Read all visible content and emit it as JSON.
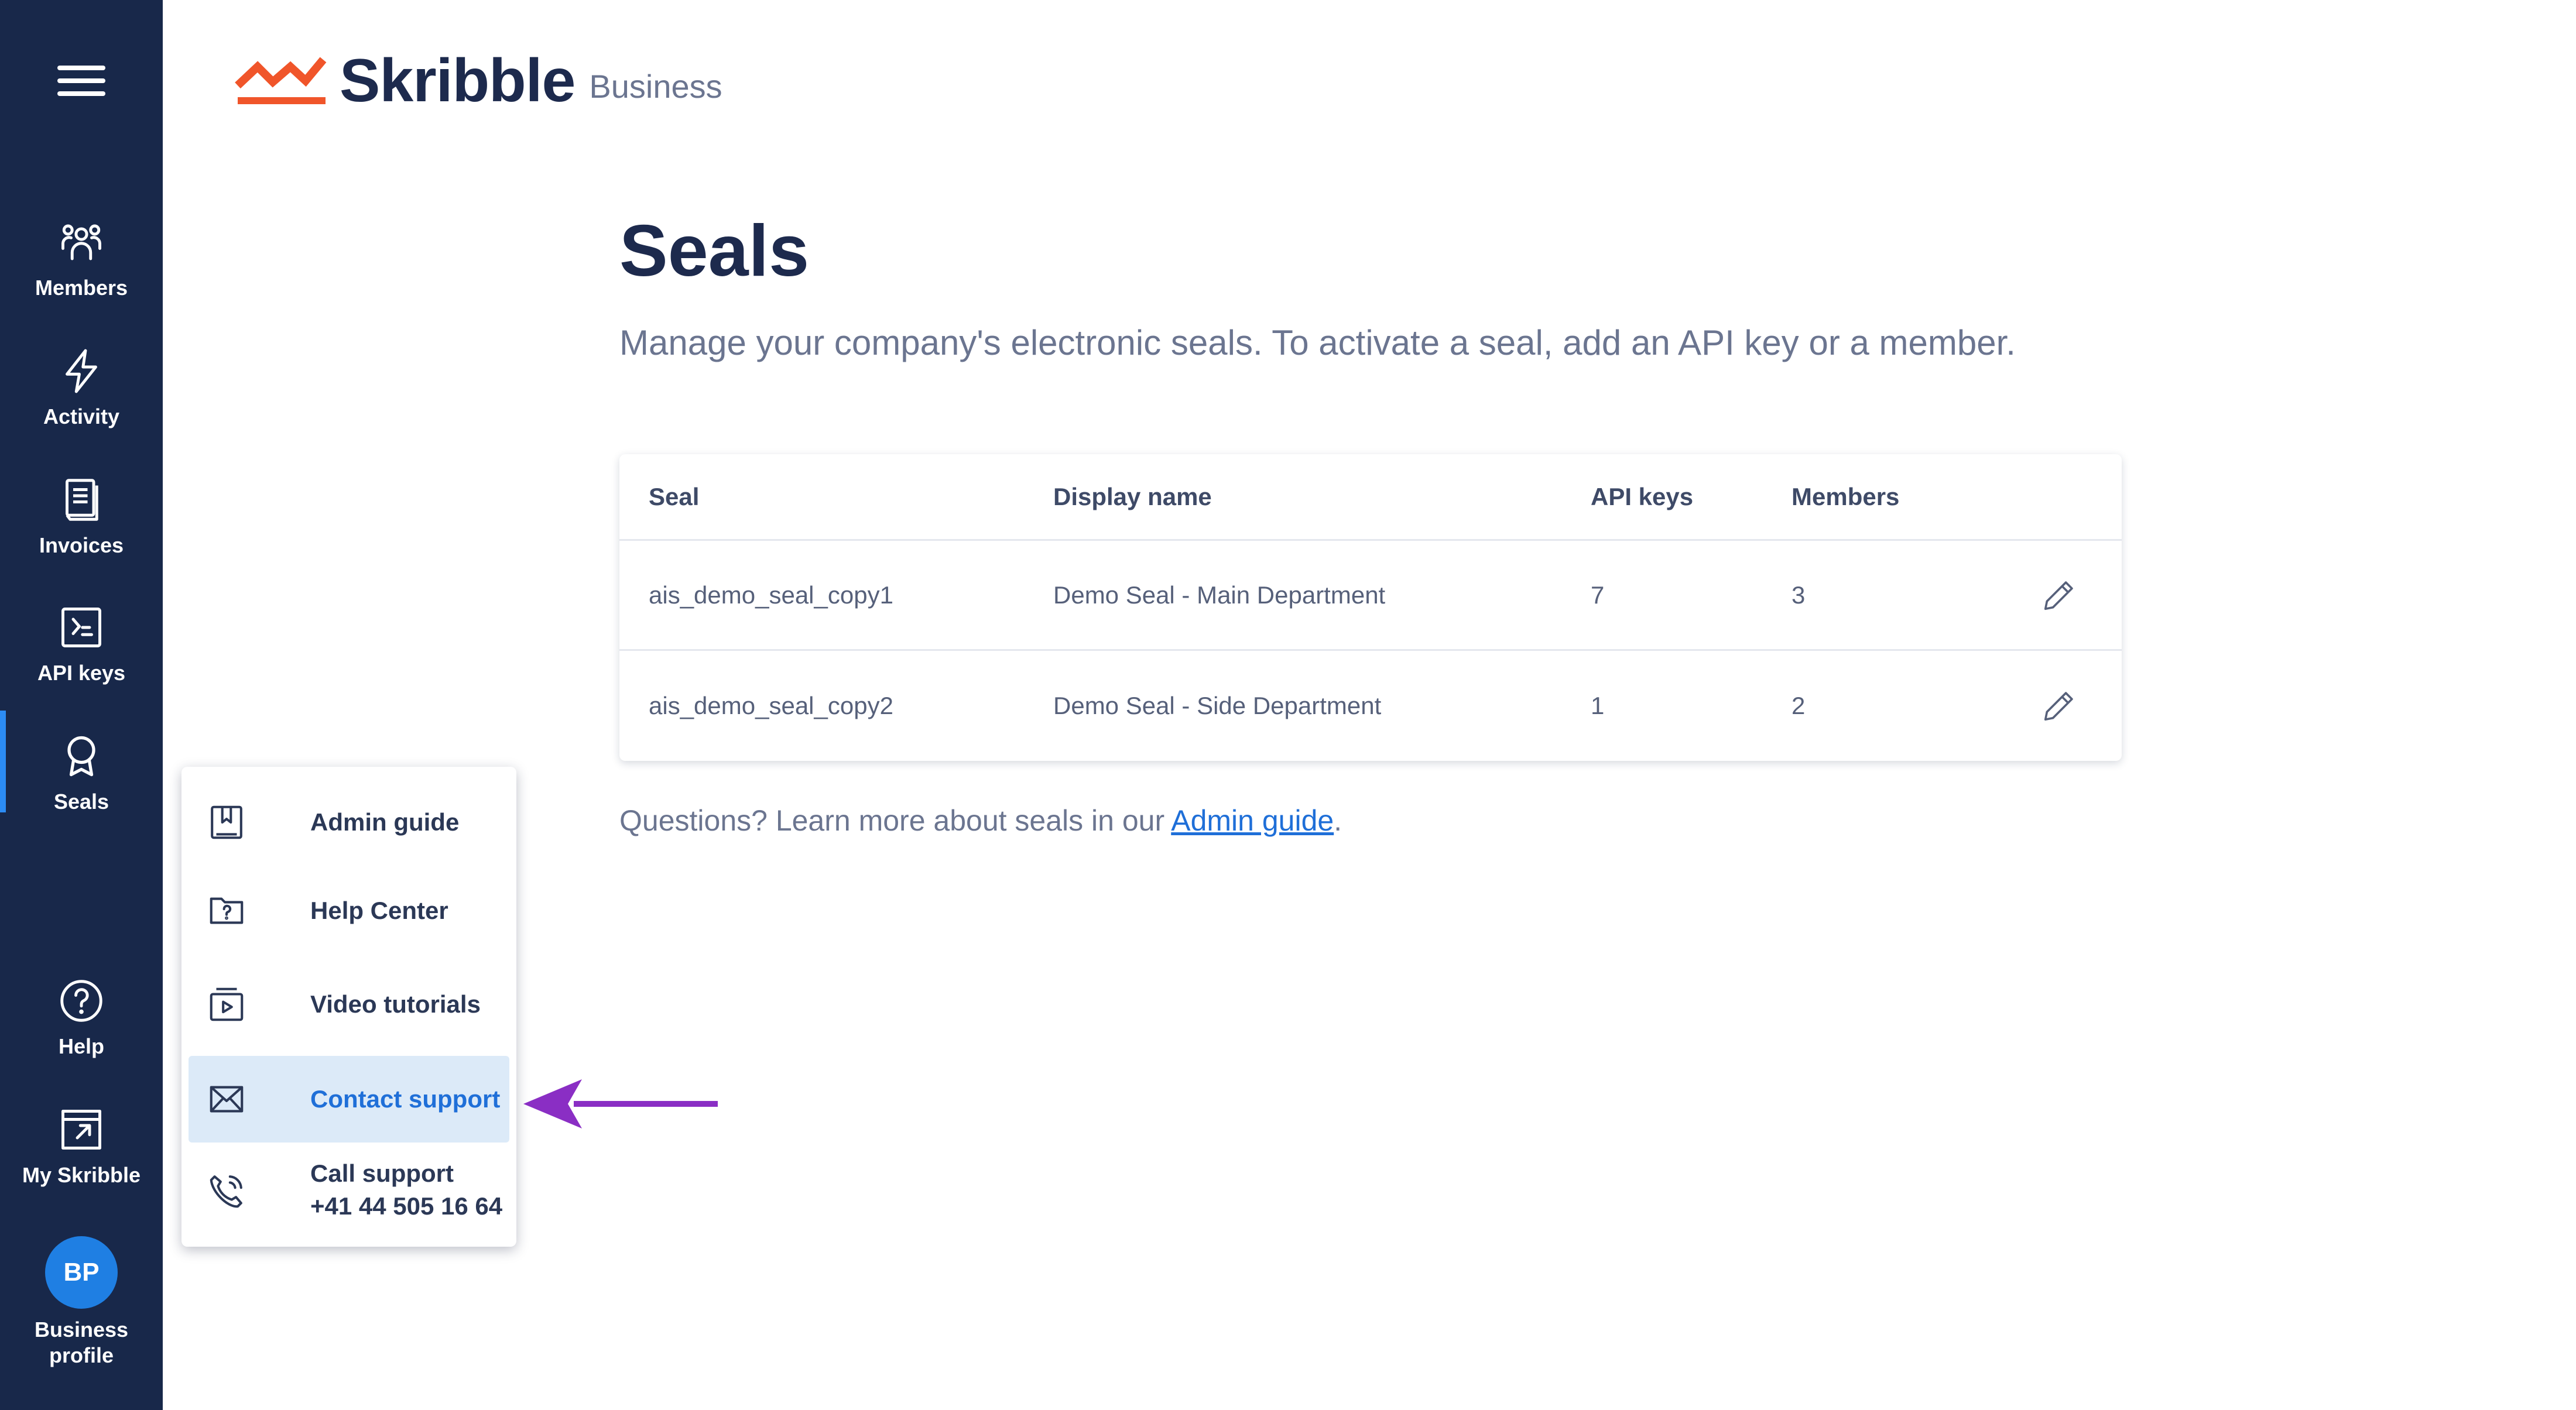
{
  "app": {
    "logo_word": "Skribble",
    "logo_sub": "Business",
    "brand_colors": {
      "logo": "#f0552a",
      "sidebar": "#18284a",
      "accent": "#1f7fe3",
      "annotation_arrow": "#8a2ec4"
    }
  },
  "sidebar": {
    "menu_icon": "hamburger-icon",
    "items": [
      {
        "label": "Members",
        "icon": "members-icon"
      },
      {
        "label": "Activity",
        "icon": "bolt-icon"
      },
      {
        "label": "Invoices",
        "icon": "document-icon"
      },
      {
        "label": "API keys",
        "icon": "terminal-icon"
      },
      {
        "label": "Seals",
        "icon": "seal-ribbon-icon",
        "active": true
      },
      {
        "label": "Help",
        "icon": "question-circle-icon"
      },
      {
        "label": "My Skribble",
        "icon": "external-window-icon"
      }
    ],
    "profile": {
      "initials": "BP",
      "label": "Business profile"
    }
  },
  "main": {
    "title": "Seals",
    "subtitle": "Manage your company's electronic seals. To activate a seal, add an API key or a member.",
    "table": {
      "columns": [
        "Seal",
        "Display name",
        "API keys",
        "Members"
      ],
      "rows": [
        {
          "seal": "ais_demo_seal_copy1",
          "display_name": "Demo Seal - Main Department",
          "api_keys": "7",
          "members": "3"
        },
        {
          "seal": "ais_demo_seal_copy2",
          "display_name": "Demo Seal - Side Department",
          "api_keys": "1",
          "members": "2"
        }
      ]
    },
    "questions": {
      "prefix": "Questions? Learn more about seals in our ",
      "link": "Admin guide",
      "suffix": "."
    }
  },
  "help_menu": {
    "items": [
      {
        "label": "Admin guide",
        "icon": "bookmark-book-icon"
      },
      {
        "label": "Help Center",
        "icon": "help-folder-icon"
      },
      {
        "label": "Video tutorials",
        "icon": "video-play-icon"
      },
      {
        "label": "Contact support",
        "icon": "mail-icon",
        "highlighted": true
      },
      {
        "label": "Call support",
        "sublabel": "+41 44 505 16 64",
        "icon": "phone-icon"
      }
    ]
  }
}
